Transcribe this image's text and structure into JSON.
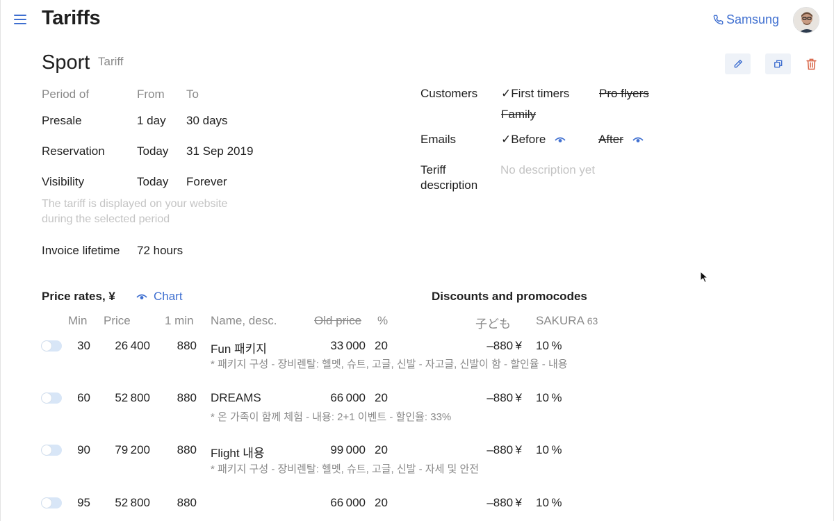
{
  "header": {
    "title": "Tariffs",
    "phone_label": "Samsung"
  },
  "tariff": {
    "name": "Sport",
    "tag": "Tariff"
  },
  "period": {
    "col_period": "Period of",
    "col_from": "From",
    "col_to": "To",
    "rows": [
      {
        "label": "Presale",
        "from": "1 day",
        "to": "30 days"
      },
      {
        "label": "Reservation",
        "from": "Today",
        "to": "31 Sep 2019"
      },
      {
        "label": "Visibility",
        "from": "Today",
        "to": "Forever"
      }
    ],
    "note_line1": "The tariff is displayed on your website",
    "note_line2": "during the selected period",
    "invoice_label": "Invoice lifetime",
    "invoice_value": "72 hours"
  },
  "customers": {
    "label": "Customers",
    "first_timers": "✓First timers",
    "pro_flyers": "Pro flyers",
    "family": "Family"
  },
  "emails": {
    "label": "Emails",
    "before": "✓Before",
    "after": "After"
  },
  "description": {
    "label_line1": "Teriff",
    "label_line2": "description",
    "placeholder": "No description yet"
  },
  "prices": {
    "title": "Price rates, ¥",
    "chart_link": "Chart",
    "discounts_title": "Discounts and promocodes",
    "columns": {
      "min": "Min",
      "price": "Price",
      "one_min": "1 min",
      "name": "Name, desc.",
      "old_price": "Old price",
      "percent": "%",
      "kids": "子ども",
      "promo": "SAKURA",
      "promo_count": "63"
    },
    "rows": [
      {
        "min": "30",
        "price": "26 400",
        "one_min": "880",
        "name": "Fun 패키지",
        "old_price": "33 000",
        "percent": "20",
        "kids": "–880 ¥",
        "promo": "10 %",
        "desc": "* 패키지 구성 - 장비렌탈: 헬멧, 슈트, 고글, 신발 - 자고글, 신발이 함  - 할인율 - 내용"
      },
      {
        "min": "60",
        "price": "52 800",
        "one_min": "880",
        "name": "DREAMS",
        "old_price": "66 000",
        "percent": "20",
        "kids": "–880 ¥",
        "promo": "10 %",
        "desc": "* 온 가족이 함께 체험  - 내용: 2+1 이벤트  - 할인율: 33%"
      },
      {
        "min": "90",
        "price": "79 200",
        "one_min": "880",
        "name": "Flight 내용",
        "old_price": "99 000",
        "percent": "20",
        "kids": "–880 ¥",
        "promo": "10 %",
        "desc": "* 패키지 구성 - 장비렌탈: 헬멧, 슈트, 고글, 신발 - 자세 및 안전"
      },
      {
        "min": "95",
        "price": "52 800",
        "one_min": "880",
        "name": "",
        "old_price": "66 000",
        "percent": "20",
        "kids": "–880 ¥",
        "promo": "10 %",
        "desc": ""
      }
    ]
  },
  "colors": {
    "accent": "#3f6fd0",
    "delete": "#d9674a",
    "toggle_off": "#d8e6f7"
  },
  "icons": [
    "menu-icon",
    "phone-icon",
    "avatar",
    "pencil-icon",
    "copy-icon",
    "trash-icon",
    "eye-icon",
    "cursor-arrow-icon"
  ]
}
